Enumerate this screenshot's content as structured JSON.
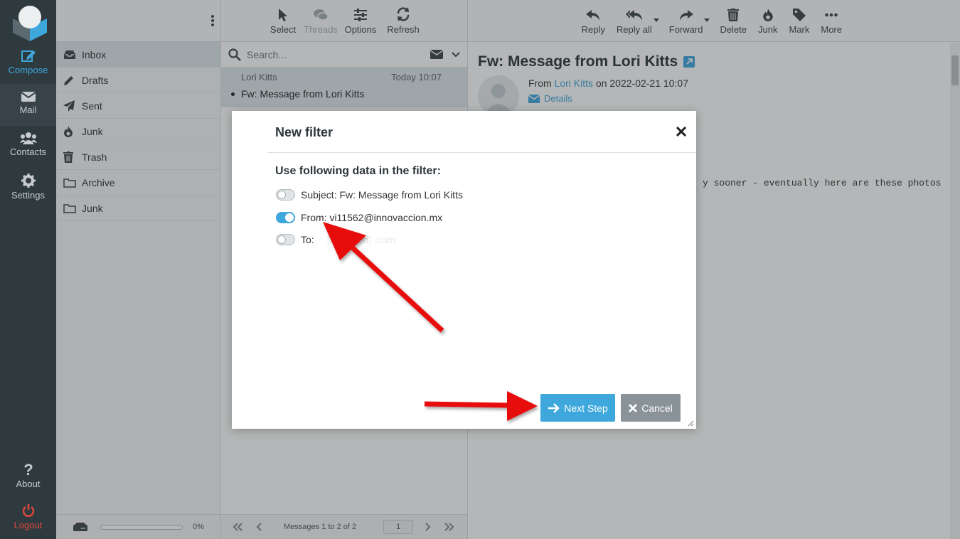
{
  "rail": {
    "items": [
      {
        "label": "Compose",
        "icon": "compose-icon"
      },
      {
        "label": "Mail",
        "icon": "mail-icon"
      },
      {
        "label": "Contacts",
        "icon": "contacts-icon"
      },
      {
        "label": "Settings",
        "icon": "settings-icon"
      }
    ],
    "about": "About",
    "logout": "Logout"
  },
  "folders": [
    {
      "label": "Inbox",
      "icon": "inbox-icon"
    },
    {
      "label": "Drafts",
      "icon": "drafts-icon"
    },
    {
      "label": "Sent",
      "icon": "sent-icon"
    },
    {
      "label": "Junk",
      "icon": "junk-fire-icon"
    },
    {
      "label": "Trash",
      "icon": "trash-icon"
    },
    {
      "label": "Archive",
      "icon": "folder-icon"
    },
    {
      "label": "Junk",
      "icon": "folder-icon"
    }
  ],
  "quota": {
    "percent_label": "0%",
    "fraction": 0
  },
  "list_toolbar": {
    "select": "Select",
    "threads": "Threads",
    "options": "Options",
    "refresh": "Refresh"
  },
  "search": {
    "placeholder": "Search..."
  },
  "messages": [
    {
      "from": "Lori Kitts",
      "date": "Today 10:07",
      "subject": "Fw: Message from Lori Kitts"
    }
  ],
  "pager": {
    "count": "Messages 1 to 2 of 2",
    "page": "1"
  },
  "preview_toolbar": {
    "reply": "Reply",
    "reply_all": "Reply all",
    "forward": "Forward",
    "delete": "Delete",
    "junk": "Junk",
    "mark": "Mark",
    "more": "More"
  },
  "mail": {
    "subject": "Fw: Message from Lori Kitts",
    "from_prefix": "From",
    "from_name": "Lori Kitts",
    "date_text": "on 2022-02-21 10:07",
    "details": "Details",
    "body_fragment": "y sooner - eventually here are these photos"
  },
  "dialog": {
    "title": "New filter",
    "heading": "Use following data in the filter:",
    "options": [
      {
        "label": "Subject: Fw: Message from Lori Kitts",
        "checked": false
      },
      {
        "label": "From: vi11562@innovaccion.mx",
        "checked": true
      },
      {
        "label": "To:",
        "checked": false
      }
    ],
    "to_redacted": "[redacted] .com",
    "next_button": "Next Step",
    "cancel_button": "Cancel"
  },
  "colors": {
    "accent": "#3ea7dc",
    "rail_bg": "#2f3a3f",
    "logout": "#e0473f",
    "annotation_arrow": "#e81010"
  }
}
